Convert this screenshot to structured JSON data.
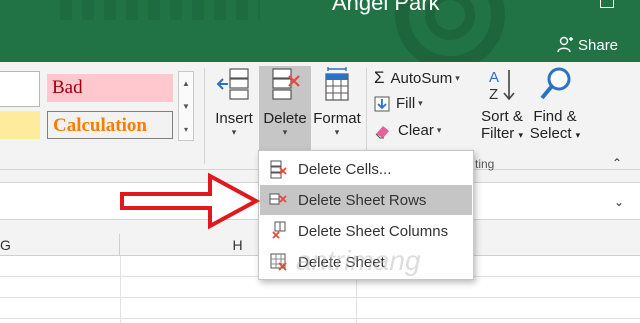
{
  "titlebar": {
    "user_name": "Angel Park",
    "share_label": "Share"
  },
  "styles": {
    "bad_label": "Bad",
    "calculation_label": "Calculation",
    "bad_bg": "#ffc7ce",
    "bad_color": "#9c0006",
    "calc_color": "#fa7d00",
    "neutral_bg": "#ffeb9c"
  },
  "cells_group": {
    "insert_label": "Insert",
    "delete_label": "Delete",
    "format_label": "Format"
  },
  "editing_group": {
    "autosum_label": "AutoSum",
    "fill_label": "Fill",
    "clear_label": "Clear",
    "sort_label_line1": "Sort &",
    "sort_label_line2": "Filter",
    "find_label_line1": "Find &",
    "find_label_line2": "Select",
    "group_label_fragment": "ting"
  },
  "delete_menu": {
    "items": [
      {
        "label": "Delete Cells...",
        "icon": "delete-cells-icon"
      },
      {
        "label": "Delete Sheet Rows",
        "icon": "delete-rows-icon"
      },
      {
        "label": "Delete Sheet Columns",
        "icon": "delete-columns-icon"
      },
      {
        "label": "Delete Sheet",
        "icon": "delete-sheet-icon"
      }
    ],
    "highlighted_index": 1
  },
  "grid": {
    "column_headers": [
      "G",
      "H"
    ]
  },
  "watermark": "antrimang",
  "colors": {
    "title_bar": "#217346",
    "arrow": "#e0191f",
    "delete_x": "#e8483e"
  }
}
